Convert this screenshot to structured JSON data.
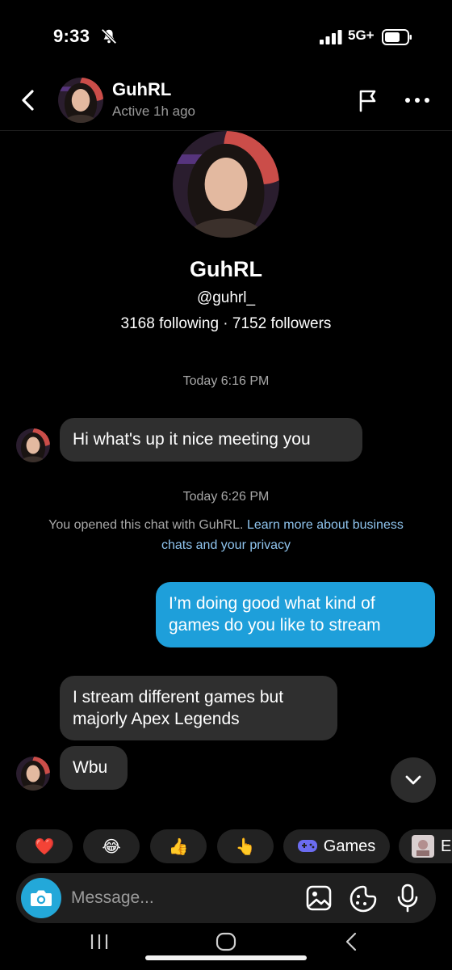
{
  "status_bar": {
    "time": "9:33",
    "network": "5G+"
  },
  "header": {
    "name": "GuhRL",
    "status": "Active 1h ago"
  },
  "profile": {
    "name": "GuhRL",
    "handle": "@guhrl_",
    "stats": "3168 following · 7152 followers"
  },
  "conversation": {
    "timestamp_1": "Today 6:16 PM",
    "message_1": "Hi what's up it nice meeting you",
    "timestamp_2": "Today 6:26 PM",
    "notice_text": "You opened this chat with GuhRL. ",
    "notice_link": "Learn more about business chats and your privacy",
    "message_2": "I’m doing good what kind of games do you like to stream",
    "message_3": "I stream different games but majorly Apex Legends",
    "message_4": "Wbu"
  },
  "quick_replies": [
    {
      "icon": "heart-emoji",
      "glyph": "❤️"
    },
    {
      "icon": "laughing-emoji",
      "glyph": "😂"
    },
    {
      "icon": "thumbs-up-emoji",
      "glyph": "👍"
    },
    {
      "icon": "pointing-emoji",
      "glyph": "👆"
    },
    {
      "icon": "gamepad-icon",
      "label": "Games"
    },
    {
      "icon": "effects-thumbnail",
      "label": "E"
    }
  ],
  "composer": {
    "placeholder": "Message..."
  },
  "colors": {
    "accent": "#23a8d9",
    "outgoing_bubble": "#1e9fda",
    "incoming_bubble": "#2f2f2f",
    "link": "#8fc4ee"
  }
}
